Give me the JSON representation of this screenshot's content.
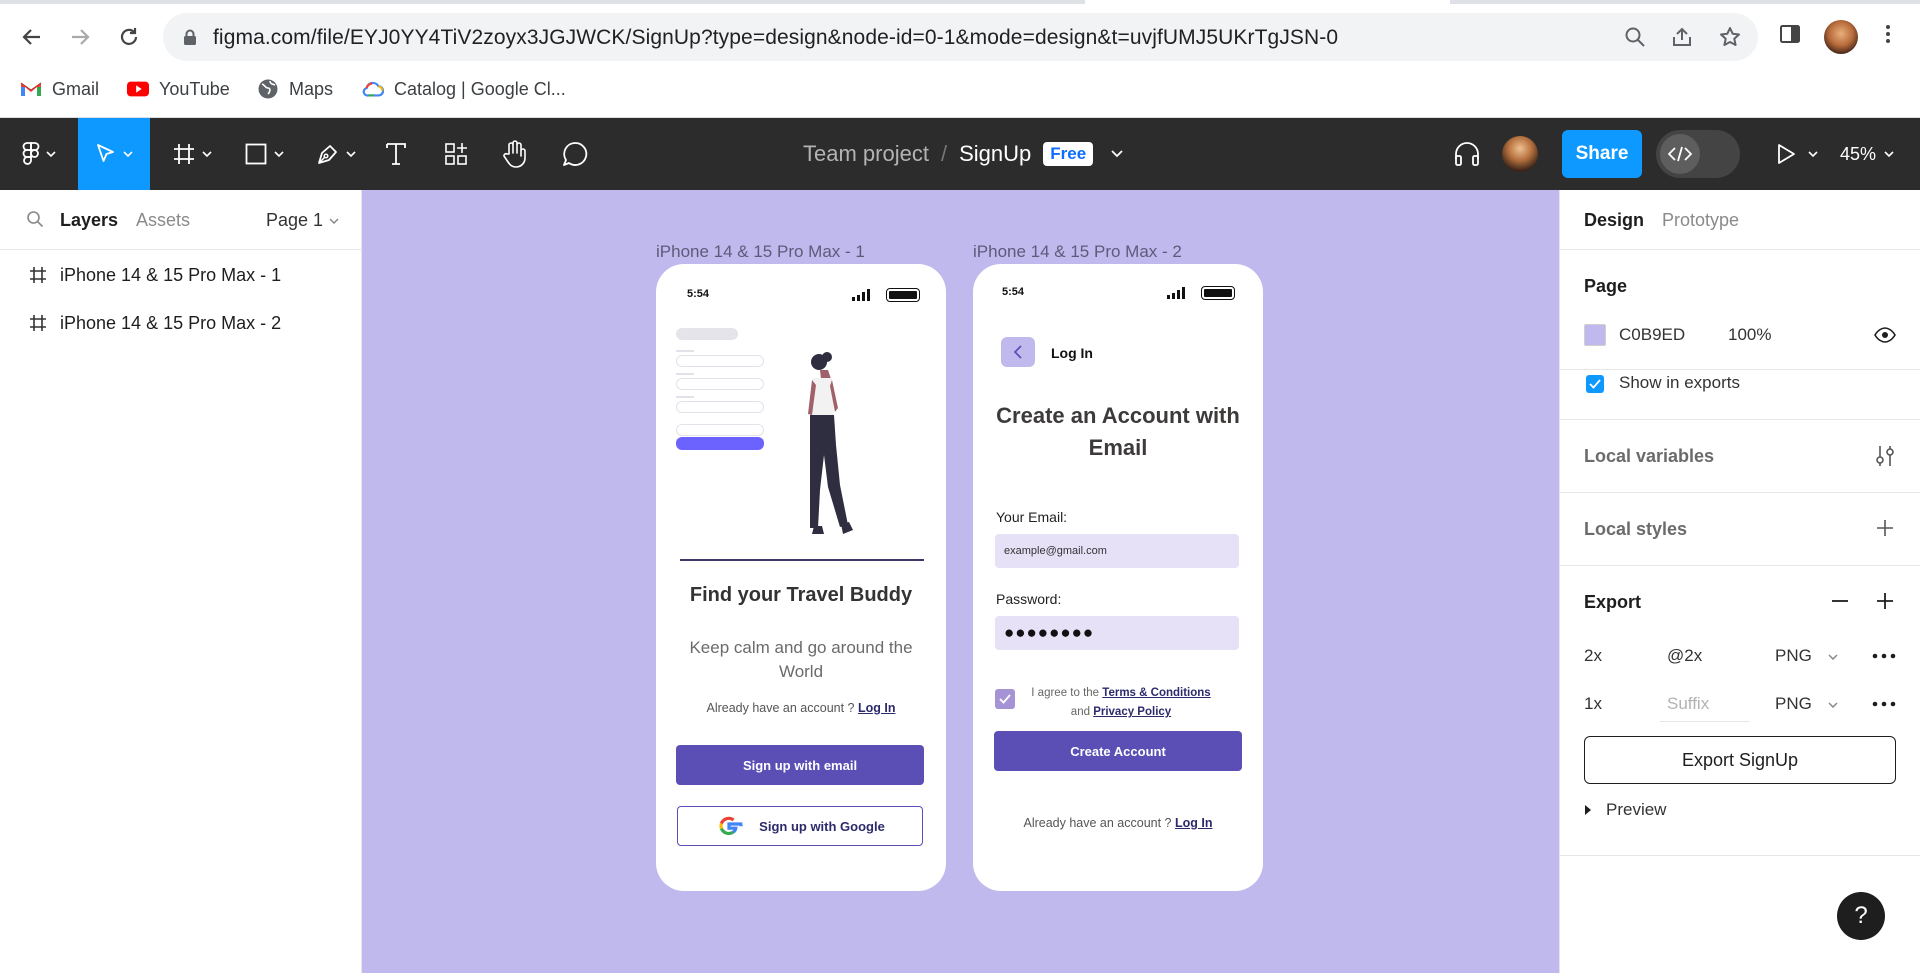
{
  "browser": {
    "url": "figma.com/file/EYJ0YY4TiV2zoyx3JGJWCK/SignUp?type=design&node-id=0-1&mode=design&t=uvjfUMJ5UKrTgJSN-0",
    "bookmarks": [
      {
        "label": "Gmail",
        "icon": "gmail-icon"
      },
      {
        "label": "YouTube",
        "icon": "youtube-icon"
      },
      {
        "label": "Maps",
        "icon": "globe-icon"
      },
      {
        "label": "Catalog | Google Cl...",
        "icon": "google-cloud-icon"
      }
    ]
  },
  "toolbar": {
    "project": "Team project",
    "separator": "/",
    "file_name": "SignUp",
    "plan_badge": "Free",
    "share_label": "Share",
    "zoom": "45%"
  },
  "left_panel": {
    "tabs": [
      "Layers",
      "Assets"
    ],
    "page_selector": "Page 1",
    "layers": [
      "iPhone 14 & 15 Pro Max - 1",
      "iPhone 14 & 15 Pro Max - 2"
    ]
  },
  "canvas": {
    "background": "#C0B9ED",
    "frames": [
      {
        "label": "iPhone 14 & 15 Pro Max - 1",
        "time": "5:54",
        "title": "Find your Travel Buddy",
        "subtitle": "Keep calm and go around the World",
        "already_text": "Already have an account ?",
        "login_link": "Log In",
        "email_button": "Sign up with email",
        "google_button": "Sign up with Google"
      },
      {
        "label": "iPhone 14 & 15 Pro Max - 2",
        "time": "5:54",
        "header": "Log In",
        "title": "Create an Account with Email",
        "email_label": "Your Email:",
        "email_value": "example@gmail.com",
        "password_label": "Password:",
        "password_value": "●●●●●●●●",
        "terms_prefix": "I agree to the",
        "terms_link": "Terms & Conditions",
        "terms_and": "and",
        "privacy_link": "Privacy Policy",
        "create_button": "Create Account",
        "already_text": "Already have an account ?",
        "login_link": "Log In"
      }
    ]
  },
  "right_panel": {
    "tabs": [
      "Design",
      "Prototype"
    ],
    "page_section": "Page",
    "page_color": "C0B9ED",
    "page_opacity": "100%",
    "show_in_exports": "Show in exports",
    "local_variables": "Local variables",
    "local_styles": "Local styles",
    "export_section": "Export",
    "export_rows": [
      {
        "scale": "2x",
        "suffix": "@2x",
        "format": "PNG"
      },
      {
        "scale": "1x",
        "suffix": "Suffix",
        "format": "PNG"
      }
    ],
    "export_button": "Export SignUp",
    "preview": "Preview"
  },
  "help": "?"
}
